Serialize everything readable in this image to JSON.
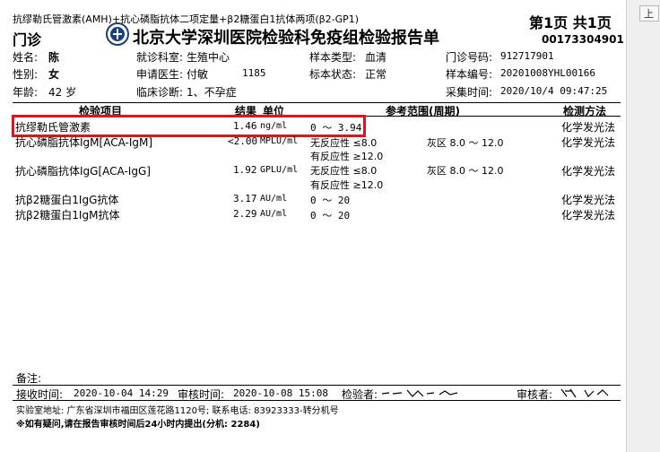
{
  "header": {
    "test_items": "抗缪勒氏管激素(AMH)+抗心磷脂抗体二项定量+β2糖蛋白1抗体两项(β2-GP1)",
    "page_label": "第1页 共1页",
    "dept": "门诊",
    "title": "北京大学深圳医院检验科免疫组检验报告单",
    "report_no": "00173304901"
  },
  "patient": {
    "name_label": "姓名:",
    "name_value": "陈",
    "dept_label": "就诊科室:",
    "dept_value": "生殖中心",
    "sample_type_label": "样本类型:",
    "sample_type_value": "血清",
    "outpatient_no_label": "门诊号码:",
    "outpatient_no_value": "912717901",
    "sex_label": "性别:",
    "sex_value": "女",
    "doctor_label": "申请医生:",
    "doctor_value": "付敏",
    "doctor_code": "1185",
    "sample_status_label": "标本状态:",
    "sample_status_value": "正常",
    "sample_no_label": "样本编号:",
    "sample_no_value": "20201008YHL00166",
    "age_label": "年龄:",
    "age_value": "42 岁",
    "diagnosis_label": "临床诊断:",
    "diagnosis_value": "1、不孕症",
    "collect_time_label": "采集时间:",
    "collect_time_value": "2020/10/4 09:47:25"
  },
  "table": {
    "headers": {
      "item": "检验项目",
      "result": "结果",
      "unit": "单位",
      "ref": "参考范围(周期)",
      "method": "检测方法"
    },
    "rows": [
      {
        "item": "抗缪勒氏管激素",
        "result": "1.46",
        "unit": "ng/ml",
        "ref1": "0 ～ 3.94",
        "ref2": "",
        "gray": "",
        "method": "化学发光法"
      },
      {
        "item": "抗心磷脂抗体IgM[ACA-IgM]",
        "result": "<2.00",
        "unit": "MPLU/ml",
        "ref1": "无反应性 ≤8.0",
        "ref2": "有反应性 ≥12.0",
        "gray": "灰区 8.0 ～ 12.0",
        "method": "化学发光法"
      },
      {
        "item": "抗心磷脂抗体IgG[ACA-IgG]",
        "result": "1.92",
        "unit": "GPLU/ml",
        "ref1": "无反应性 ≤8.0",
        "ref2": "有反应性 ≥12.0",
        "gray": "灰区 8.0 ～ 12.0",
        "method": "化学发光法"
      },
      {
        "item": "抗β2糖蛋白1IgG抗体",
        "result": "3.17",
        "unit": "AU/ml",
        "ref1": "0 ～ 20",
        "ref2": "",
        "gray": "",
        "method": "化学发光法"
      },
      {
        "item": "抗β2糖蛋白1IgM抗体",
        "result": "2.29",
        "unit": "AU/ml",
        "ref1": "0 ～ 20",
        "ref2": "",
        "gray": "",
        "method": "化学发光法"
      }
    ]
  },
  "footer": {
    "remark_label": "备注:",
    "receive_label": "接收时间:",
    "receive_value": "2020-10-04 14:29",
    "review_time_label": "审核时间:",
    "review_time_value": "2020-10-08 15:08",
    "tester_label": "检验者:",
    "reviewer_label": "审核者:",
    "lab_address": "实验室地址: 广东省深圳市福田区莲花路1120号; 联系电话: 83923333-转分机号",
    "notice": "※如有疑问,请在报告审核时间后24小时内提出(分机: 2284)"
  },
  "sidebar": {
    "button_label": "上"
  },
  "colors": {
    "highlight_border": "#e2141b",
    "sidebar_bg": "#f0f0f0"
  }
}
